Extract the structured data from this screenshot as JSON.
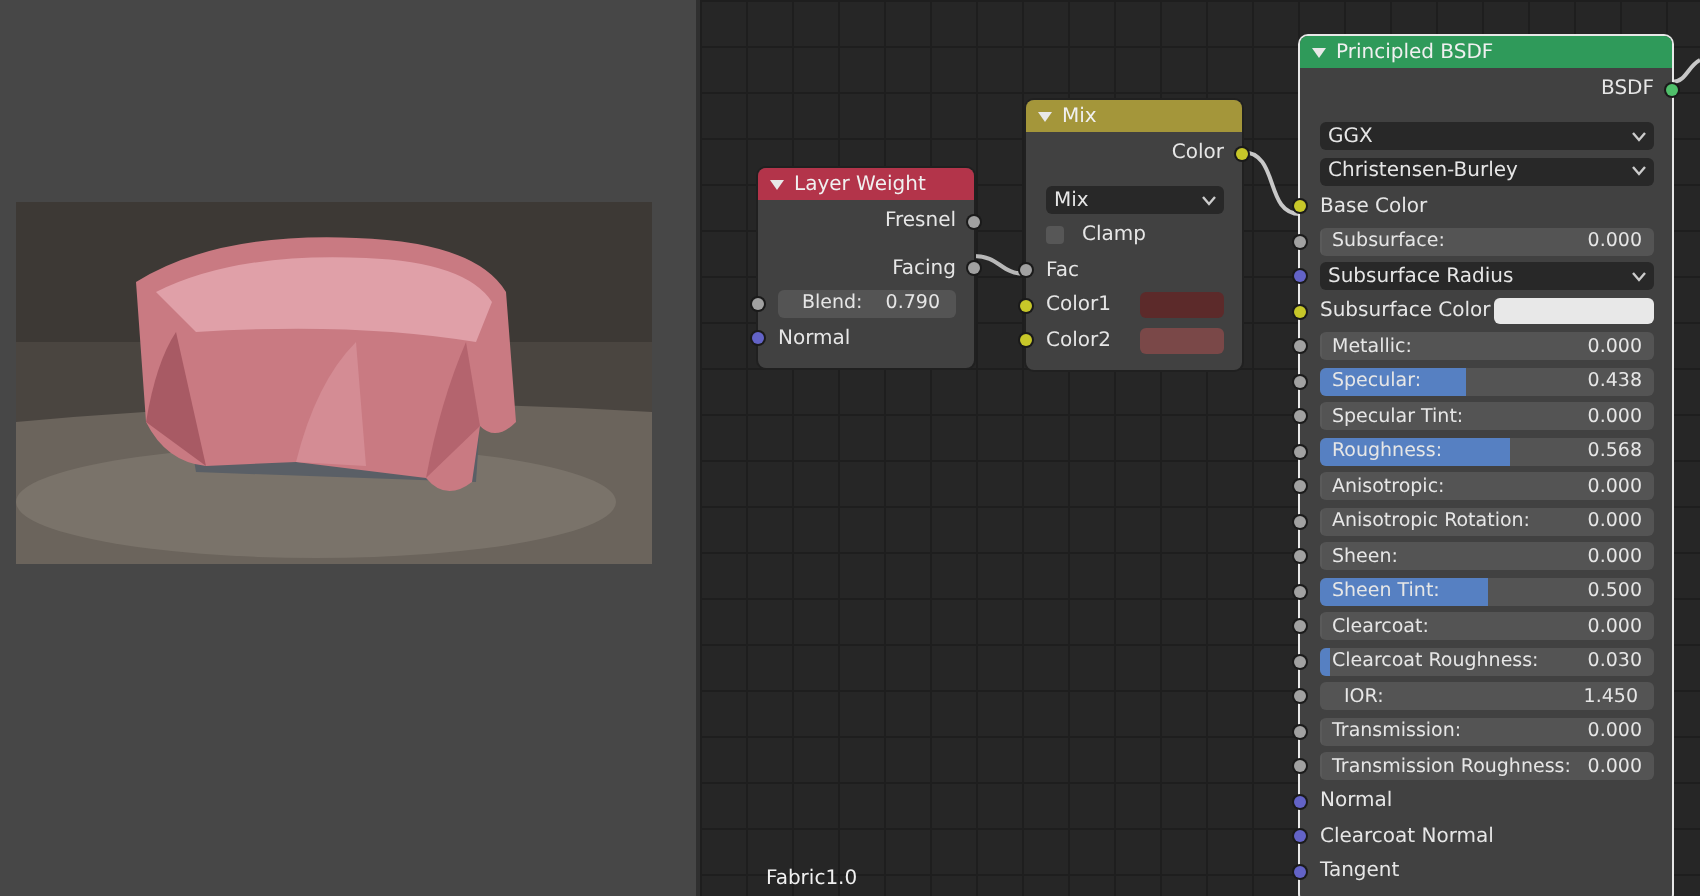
{
  "nodes": [
    {
      "title": "Layer Weight",
      "color": "#b3344a",
      "rows": [
        {
          "kind": "output",
          "label": "Fresnel",
          "color": "#a1a1a1"
        },
        {
          "kind": "output",
          "label": "Facing",
          "color": "#a1a1a1"
        },
        {
          "kind": "number",
          "label": "Blend:",
          "value": "0.790",
          "color": "#a1a1a1"
        },
        {
          "kind": "input",
          "label": "Normal",
          "color": "#6363c7"
        }
      ]
    },
    {
      "title": "Mix",
      "color": "#a4963a",
      "rows": [
        {
          "kind": "output",
          "label": "Color",
          "color": "#c7c729"
        },
        {
          "kind": "dropdown",
          "label": "Mix"
        },
        {
          "kind": "checkbox",
          "label": "Clamp",
          "checked": false
        },
        {
          "kind": "input",
          "label": "Fac",
          "color": "#a1a1a1"
        },
        {
          "kind": "color",
          "label": "Color1",
          "color": "#c7c729",
          "swatch": {
            "color": "#5c2a2a"
          }
        },
        {
          "kind": "color",
          "label": "Color2",
          "color": "#c7c729",
          "swatch": {
            "color": "#7a4848"
          }
        }
      ]
    },
    {
      "title": "Principled BSDF",
      "color": "#2f9a5a",
      "rows": [
        {
          "kind": "output",
          "label": "BSDF",
          "color": "#4fbf6a"
        },
        {
          "kind": "dropdown",
          "label": "GGX"
        },
        {
          "kind": "dropdown",
          "label": "Christensen-Burley"
        },
        {
          "kind": "input",
          "label": "Base Color",
          "color": "#c7c729"
        },
        {
          "kind": "slider",
          "label": "Subsurface:",
          "value": "0.000",
          "level": 0,
          "color": "#a1a1a1"
        },
        {
          "kind": "dropdown",
          "label": "Subsurface Radius",
          "color": "#6363c7"
        },
        {
          "kind": "color",
          "label": "Subsurface Color",
          "color": "#c7c729",
          "swatch": {
            "color": "#e8e8e8"
          }
        },
        {
          "kind": "slider",
          "label": "Metallic:",
          "value": "0.000",
          "level": 0,
          "color": "#a1a1a1"
        },
        {
          "kind": "slider",
          "label": "Specular:",
          "value": "0.438",
          "level": 0.438,
          "color": "#a1a1a1"
        },
        {
          "kind": "slider",
          "label": "Specular Tint:",
          "value": "0.000",
          "level": 0,
          "color": "#a1a1a1"
        },
        {
          "kind": "slider",
          "label": "Roughness:",
          "value": "0.568",
          "level": 0.568,
          "color": "#a1a1a1"
        },
        {
          "kind": "slider",
          "label": "Anisotropic:",
          "value": "0.000",
          "level": 0,
          "color": "#a1a1a1"
        },
        {
          "kind": "slider",
          "label": "Anisotropic Rotation:",
          "value": "0.000",
          "level": 0,
          "color": "#a1a1a1"
        },
        {
          "kind": "slider",
          "label": "Sheen:",
          "value": "0.000",
          "level": 0,
          "color": "#a1a1a1"
        },
        {
          "kind": "slider",
          "label": "Sheen Tint:",
          "value": "0.500",
          "level": 0.5,
          "color": "#a1a1a1"
        },
        {
          "kind": "slider",
          "label": "Clearcoat:",
          "value": "0.000",
          "level": 0,
          "color": "#a1a1a1"
        },
        {
          "kind": "slider",
          "label": "Clearcoat Roughness:",
          "value": "0.030",
          "level": 0.03,
          "color": "#a1a1a1"
        },
        {
          "kind": "number",
          "label": "IOR:",
          "value": "1.450",
          "color": "#a1a1a1"
        },
        {
          "kind": "slider",
          "label": "Transmission:",
          "value": "0.000",
          "level": 0,
          "color": "#a1a1a1"
        },
        {
          "kind": "slider",
          "label": "Transmission Roughness:",
          "value": "0.000",
          "level": 0,
          "color": "#a1a1a1"
        },
        {
          "kind": "input",
          "label": "Normal",
          "color": "#6363c7"
        },
        {
          "kind": "input",
          "label": "Clearcoat Normal",
          "color": "#6363c7"
        },
        {
          "kind": "input",
          "label": "Tangent",
          "color": "#6363c7"
        }
      ]
    }
  ],
  "frame_label": "Fabric1.0"
}
